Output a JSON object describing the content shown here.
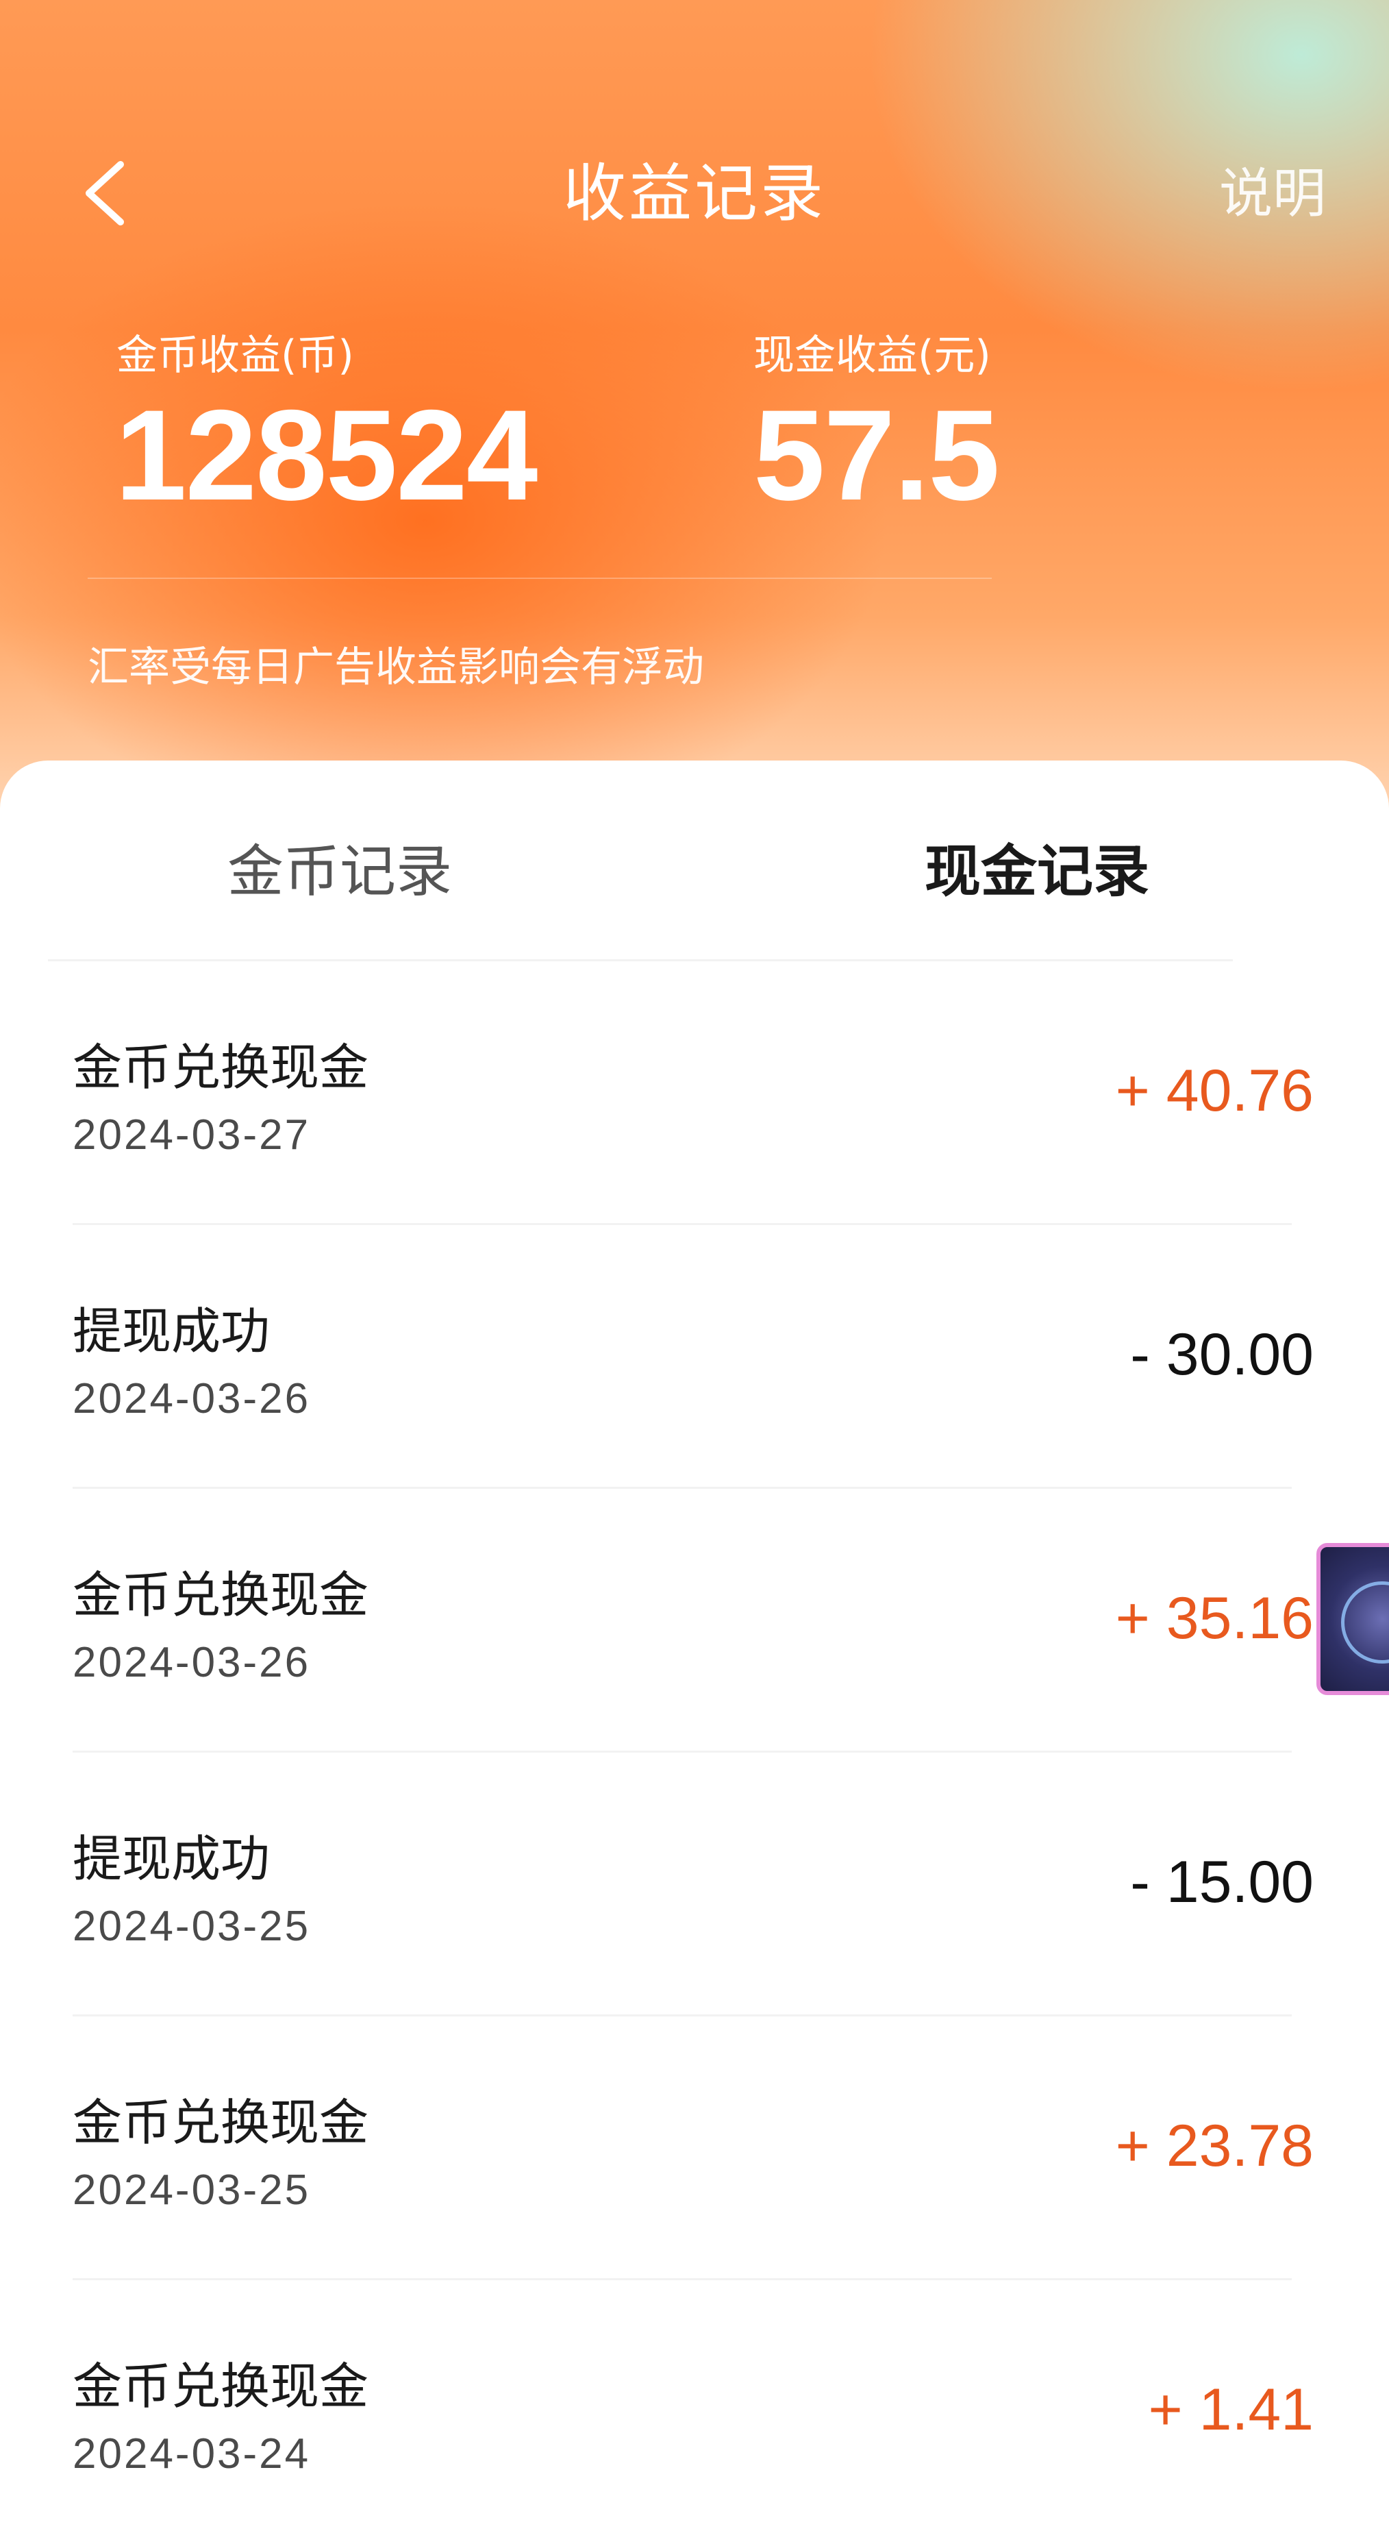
{
  "header": {
    "title": "收益记录",
    "help_label": "说明",
    "coins": {
      "label": "金币收益(币)",
      "value": "128524"
    },
    "cash": {
      "label": "现金收益(元)",
      "value": "57.5"
    },
    "note": "汇率受每日广告收益影响会有浮动"
  },
  "tabs": [
    {
      "label": "金币记录",
      "active": false
    },
    {
      "label": "现金记录",
      "active": true
    }
  ],
  "records": [
    {
      "title": "金币兑换现金",
      "date": "2024-03-27",
      "amount": "+ 40.76",
      "type": "income"
    },
    {
      "title": "提现成功",
      "date": "2024-03-26",
      "amount": "- 30.00",
      "type": "expense"
    },
    {
      "title": "金币兑换现金",
      "date": "2024-03-26",
      "amount": "+ 35.16",
      "type": "income"
    },
    {
      "title": "提现成功",
      "date": "2024-03-25",
      "amount": "- 15.00",
      "type": "expense"
    },
    {
      "title": "金币兑换现金",
      "date": "2024-03-25",
      "amount": "+ 23.78",
      "type": "income"
    },
    {
      "title": "金币兑换现金",
      "date": "2024-03-24",
      "amount": "+ 1.41",
      "type": "income"
    }
  ],
  "colors": {
    "accent": "#e8591e",
    "header_orange": "#ff8a40"
  },
  "icons": {
    "back": "chevron-left-icon",
    "floating": "floating-assistant-icon"
  }
}
